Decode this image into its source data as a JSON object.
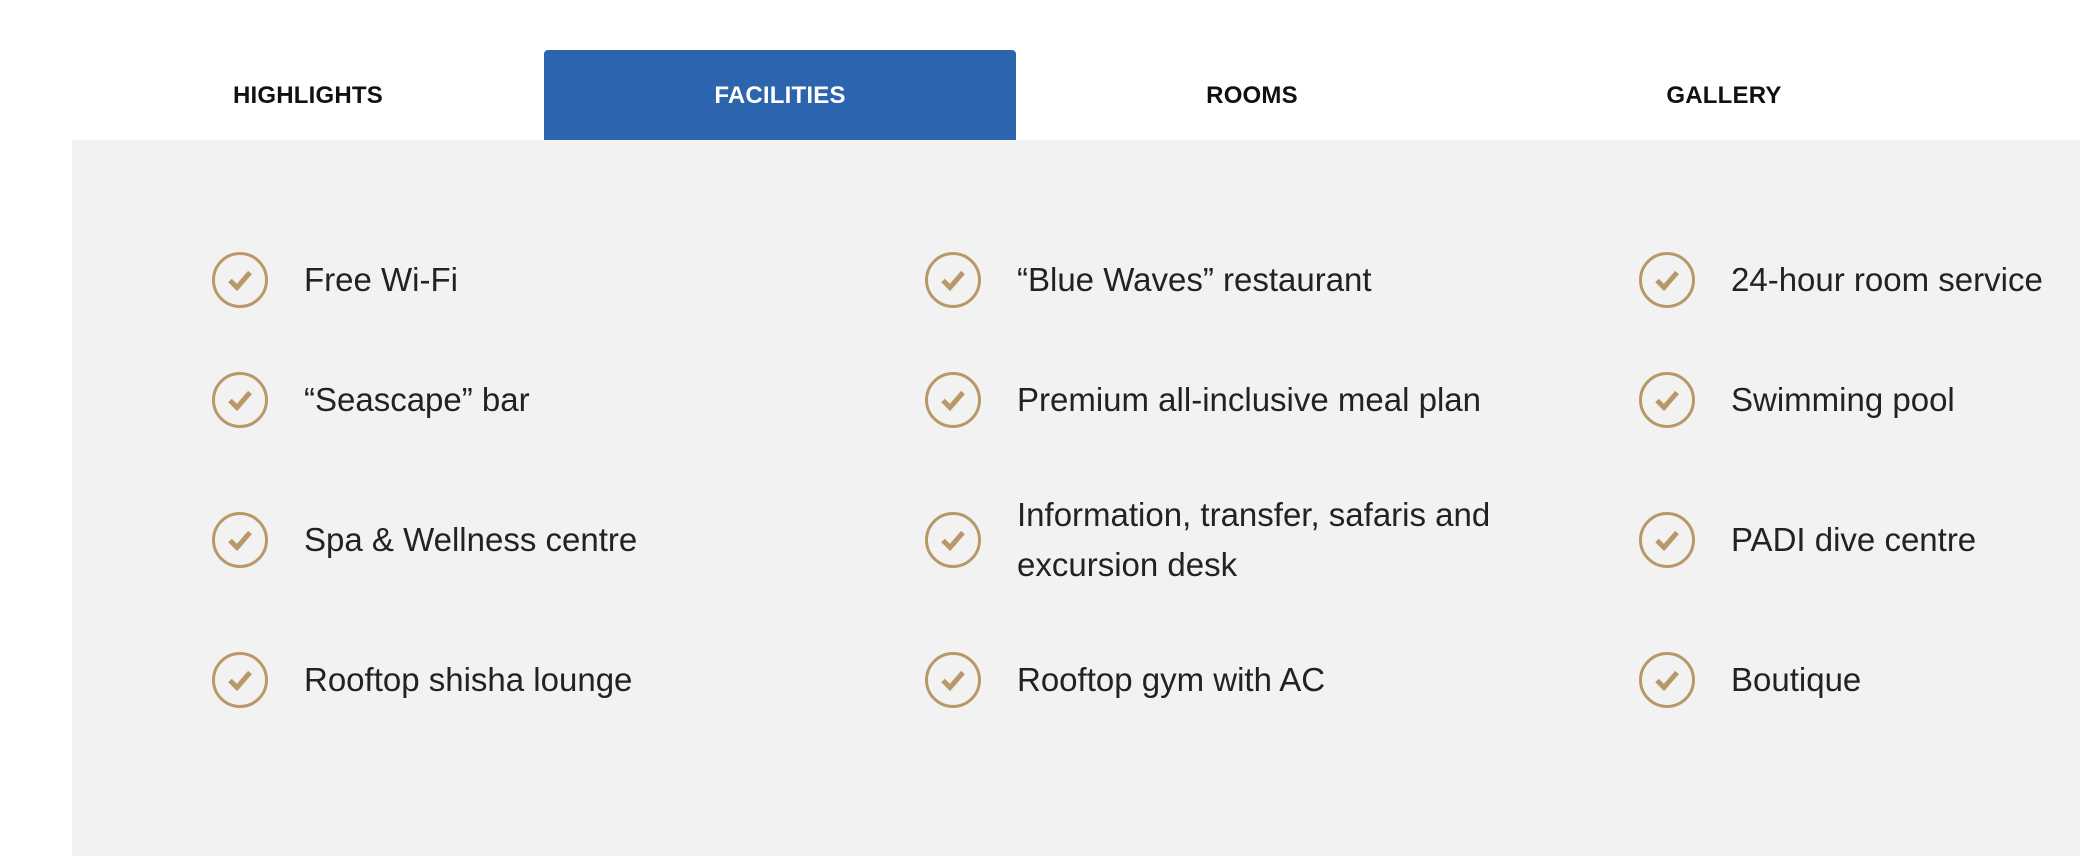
{
  "tabs": [
    {
      "label": "HIGHLIGHTS",
      "active": false
    },
    {
      "label": "FACILITIES",
      "active": true
    },
    {
      "label": "ROOMS",
      "active": false
    },
    {
      "label": "GALLERY",
      "active": false
    }
  ],
  "colors": {
    "active_tab": "#2d64ae",
    "panel_bg": "#f2f2f2",
    "check_accent": "#b79866",
    "text": "#222222"
  },
  "facilities": {
    "icon": "check-circle-icon",
    "columns": [
      [
        "Free Wi-Fi",
        "“Seascape” bar",
        "Spa & Wellness centre",
        "Rooftop shisha lounge"
      ],
      [
        "“Blue Waves” restaurant",
        "Premium all-inclusive meal plan",
        "Information, transfer, safaris and excursion desk",
        "Rooftop gym with AC"
      ],
      [
        "24-hour room service",
        "Swimming pool",
        "PADI dive centre",
        "Boutique"
      ]
    ]
  }
}
